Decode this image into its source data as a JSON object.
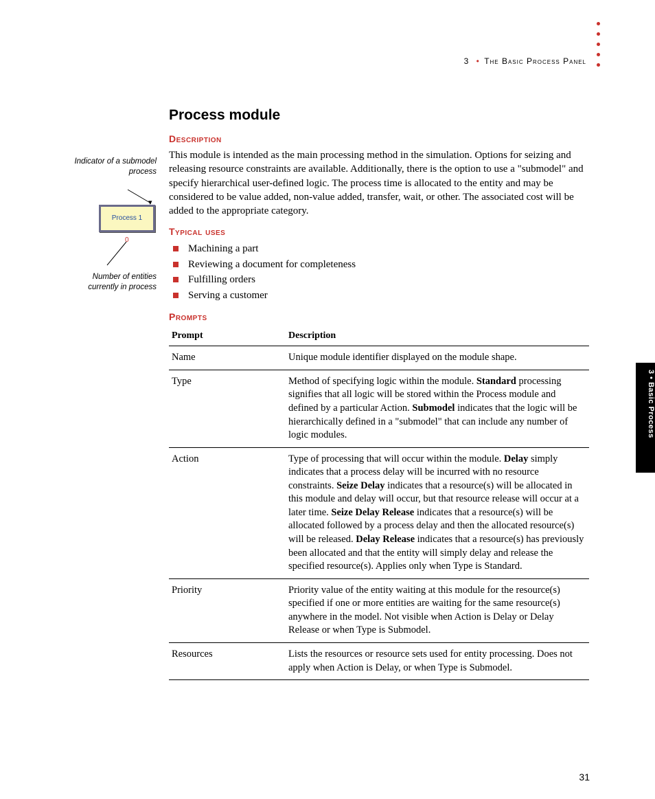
{
  "header": {
    "chapter_num": "3",
    "chapter_title": "The Basic Process Panel"
  },
  "sidebar": {
    "caption_top": "Indicator of a submodel process",
    "process_label": "Process 1",
    "count_value": "0",
    "caption_bottom": "Number of entities currently in process"
  },
  "title": "Process module",
  "sections": {
    "description": {
      "heading": "Description",
      "body": "This module is intended as the main processing method in the simulation. Options for seizing and releasing resource constraints are available. Additionally, there is the option to use a \"submodel\" and specify hierarchical user-defined logic. The process time is allocated to the entity and may be considered to be value added, non-value added, transfer, wait, or other. The associated cost will be added to the appropriate category."
    },
    "typical_uses": {
      "heading": "Typical uses",
      "items": [
        "Machining a part",
        "Reviewing a document for completeness",
        "Fulfilling orders",
        "Serving a customer"
      ]
    },
    "prompts": {
      "heading": "Prompts",
      "col_prompt": "Prompt",
      "col_desc": "Description",
      "rows": [
        {
          "prompt": "Name",
          "desc": "Unique module identifier displayed on the module shape."
        },
        {
          "prompt": "Type",
          "desc": "Method of specifying logic within the module. <b>Standard</b> processing signifies that all logic will be stored within the Process module and defined by a particular Action. <b>Submodel</b> indicates that the logic will be hierarchically defined in a \"submodel\" that can include any number of logic modules."
        },
        {
          "prompt": "Action",
          "desc": "Type of processing that will occur within the module. <b>Delay</b> simply indicates that a process delay will be incurred with no resource constraints. <b>Seize Delay</b> indicates that a resource(s) will be allocated in this module and delay will occur, but that resource release will occur at a later time. <b>Seize Delay Release</b> indicates that a resource(s) will be allocated followed by a process delay and then the allocated resource(s) will be released. <b>Delay Release</b> indicates that a resource(s) has previously been allocated and that the entity will simply delay and release the specified resource(s). Applies only when Type is Standard."
        },
        {
          "prompt": "Priority",
          "desc": "Priority value of the entity waiting at this module for the resource(s) specified if one or more entities are waiting for the same resource(s) anywhere in the model. Not visible when Action is Delay or Delay Release or when Type is Submodel."
        },
        {
          "prompt": "Resources",
          "desc": "Lists the resources or resource sets used for entity processing. Does not apply when Action is Delay, or when Type is Submodel."
        }
      ]
    }
  },
  "thumb_tab": {
    "chapter": "3",
    "label": "Basic Process"
  },
  "page_number": "31"
}
